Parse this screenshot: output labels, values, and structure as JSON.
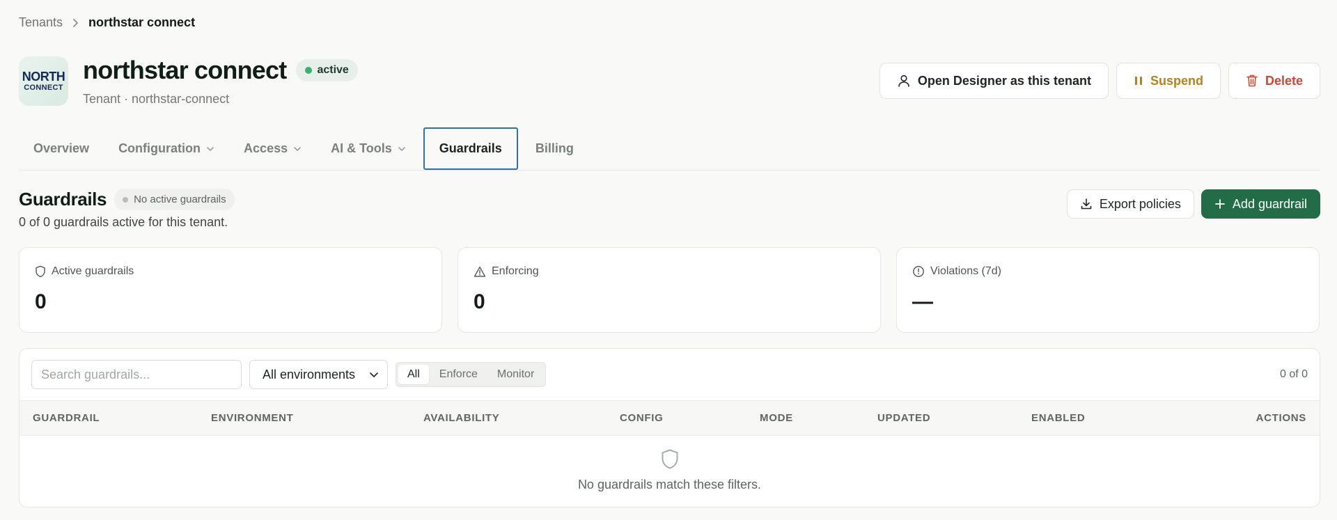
{
  "breadcrumb": {
    "root": "Tenants",
    "current": "northstar connect"
  },
  "tenant": {
    "logo_line1": "NORTH",
    "logo_line2": "CONNECT",
    "name": "northstar connect",
    "status": "active",
    "subtitle": "Tenant · northstar-connect"
  },
  "header_actions": {
    "open_designer": "Open Designer as this tenant",
    "suspend": "Suspend",
    "delete": "Delete"
  },
  "tabs": [
    {
      "label": "Overview"
    },
    {
      "label": "Configuration"
    },
    {
      "label": "Access"
    },
    {
      "label": "AI & Tools"
    },
    {
      "label": "Guardrails"
    },
    {
      "label": "Billing"
    }
  ],
  "guardrails": {
    "title": "Guardrails",
    "badge": "No active guardrails",
    "subtitle": "0 of 0 guardrails active for this tenant.",
    "export_label": "Export policies",
    "add_label": "Add guardrail"
  },
  "stats": {
    "active": {
      "label": "Active guardrails",
      "value": "0"
    },
    "enforcing": {
      "label": "Enforcing",
      "value": "0"
    },
    "violations": {
      "label": "Violations (7d)",
      "value": "—"
    }
  },
  "filters": {
    "search_placeholder": "Search guardrails...",
    "environment": "All environments",
    "modes": [
      "All",
      "Enforce",
      "Monitor"
    ],
    "count": "0 of 0"
  },
  "table": {
    "columns": [
      "GUARDRAIL",
      "ENVIRONMENT",
      "AVAILABILITY",
      "CONFIG",
      "MODE",
      "UPDATED",
      "ENABLED",
      "ACTIONS"
    ],
    "empty_message": "No guardrails match these filters."
  },
  "colors": {
    "primary": "#226d48",
    "active_tab_border": "#2f6fb5",
    "suspend": "#b5821b",
    "delete": "#cf4633",
    "status_dot": "#35b36a"
  }
}
